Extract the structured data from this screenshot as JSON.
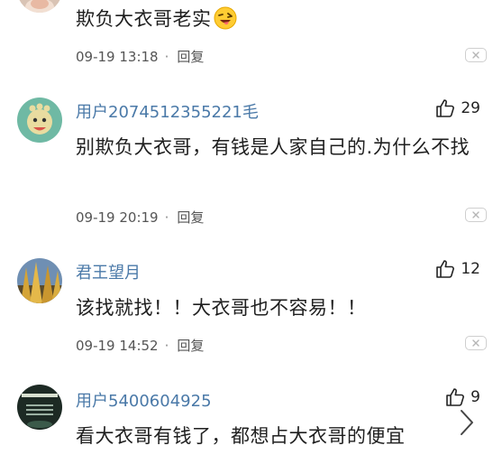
{
  "comments": [
    {
      "username": "",
      "text": "欺负大衣哥老实",
      "emoji": "😜",
      "time": "09-19 13:18",
      "reply_label": "回复",
      "likes": ""
    },
    {
      "username": "用户2074512355221毛",
      "text": "别欺负大衣哥，有钱是人家自己的.为什么不找",
      "time": "09-19 20:19",
      "reply_label": "回复",
      "likes": "29"
    },
    {
      "username": "君王望月",
      "text": "该找就找！！大衣哥也不容易！！",
      "time": "09-19 14:52",
      "reply_label": "回复",
      "likes": "12"
    },
    {
      "username": "用户5400604925",
      "text": "看大衣哥有钱了，都想占大衣哥的便宜",
      "time": "",
      "reply_label": "",
      "likes": "9"
    }
  ],
  "colors": {
    "username": "#4a79a8",
    "text": "#1f1f1f",
    "meta": "#555555"
  },
  "icons": {
    "like": "thumbs-up-icon",
    "close": "close-icon",
    "next": "chevron-right-icon"
  }
}
